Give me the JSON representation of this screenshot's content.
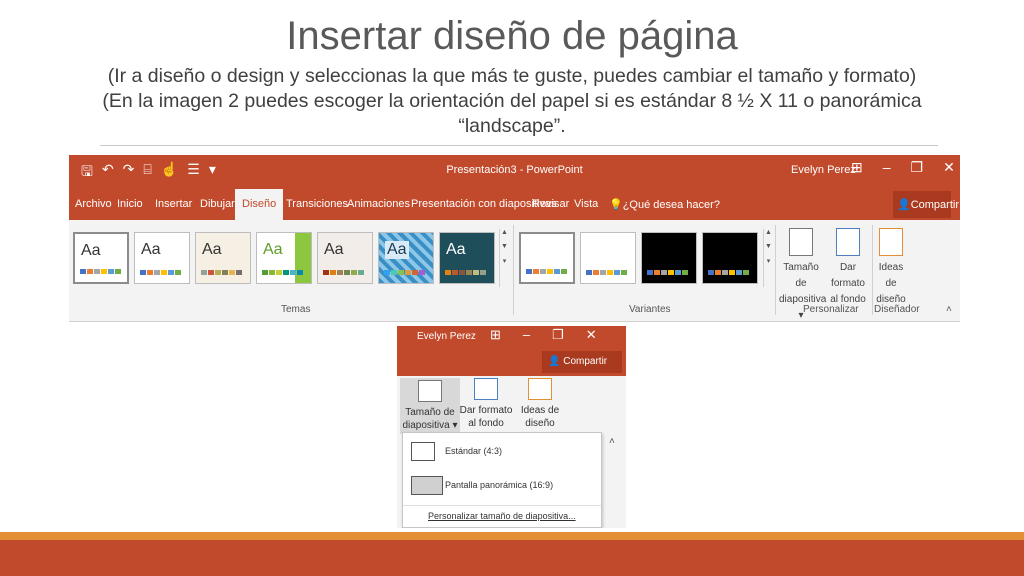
{
  "slide": {
    "title": "Insertar diseño de página",
    "subtitle": "(Ir a diseño o design y seleccionas la que más te guste, puedes cambiar el tamaño y formato) (En la imagen 2 puedes escoger la orientación del papel si es estándar 8 ½ X 11 o panorámica “landscape”."
  },
  "ribbon1": {
    "app_title": "Presentación3 - PowerPoint",
    "user": "Evelyn Perez",
    "share": "Compartir",
    "tabs": [
      "Archivo",
      "Inicio",
      "Insertar",
      "Dibujar",
      "Diseño",
      "Transiciones",
      "Animaciones",
      "Presentación con diapositivas",
      "Revisar",
      "Vista",
      "¿Qué desea hacer?"
    ],
    "active_tab": "Diseño",
    "theme_thumb_text": "Aa",
    "groups": {
      "temas": "Temas",
      "variantes": "Variantes",
      "personalizar": "Personalizar",
      "disenador": "Diseñador"
    },
    "buttons": {
      "size_line1": "Tamaño de",
      "size_line2": "diapositiva",
      "bg_line1": "Dar formato",
      "bg_line2": "al fondo",
      "ideas_line1": "Ideas de",
      "ideas_line2": "diseño"
    }
  },
  "shot2": {
    "user": "Evelyn Perez",
    "share": "Compartir",
    "size_line1": "Tamaño de",
    "size_line2": "diapositiva",
    "bg_line1": "Dar formato",
    "bg_line2": "al fondo",
    "ideas_line1": "Ideas de",
    "ideas_line2": "diseño",
    "menu": {
      "standard": "Estándar (4:3)",
      "widescreen": "Pantalla panorámica (16:9)",
      "custom": "Personalizar tamaño de diapositiva..."
    }
  },
  "colors": {
    "ribbon": "#c24a2c",
    "accent_bar": "#e38f36"
  }
}
